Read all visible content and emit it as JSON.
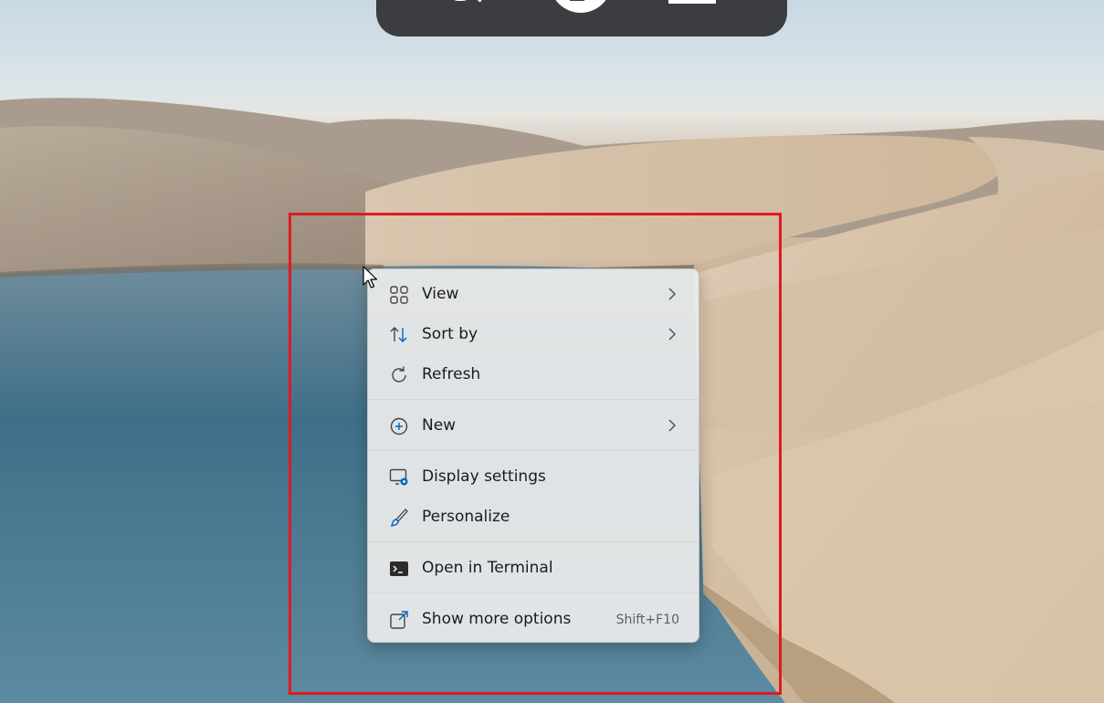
{
  "context_menu": {
    "items": [
      {
        "label": "View",
        "icon": "view-grid-icon",
        "has_submenu": true
      },
      {
        "label": "Sort by",
        "icon": "sort-arrows-icon",
        "has_submenu": true
      },
      {
        "label": "Refresh",
        "icon": "refresh-icon",
        "has_submenu": false
      },
      {
        "label": "New",
        "icon": "plus-circle-icon",
        "has_submenu": true
      },
      {
        "label": "Display settings",
        "icon": "display-settings-icon",
        "has_submenu": false
      },
      {
        "label": "Personalize",
        "icon": "brush-icon",
        "has_submenu": false
      },
      {
        "label": "Open in Terminal",
        "icon": "terminal-icon",
        "has_submenu": false
      },
      {
        "label": "Show more options",
        "icon": "external-link-icon",
        "has_submenu": false,
        "shortcut": "Shift+F10"
      }
    ]
  },
  "colors": {
    "highlight_frame": "#e01a22",
    "accent": "#0067c0",
    "menu_background": "#ececec",
    "taskbar": "#3b3d40"
  }
}
